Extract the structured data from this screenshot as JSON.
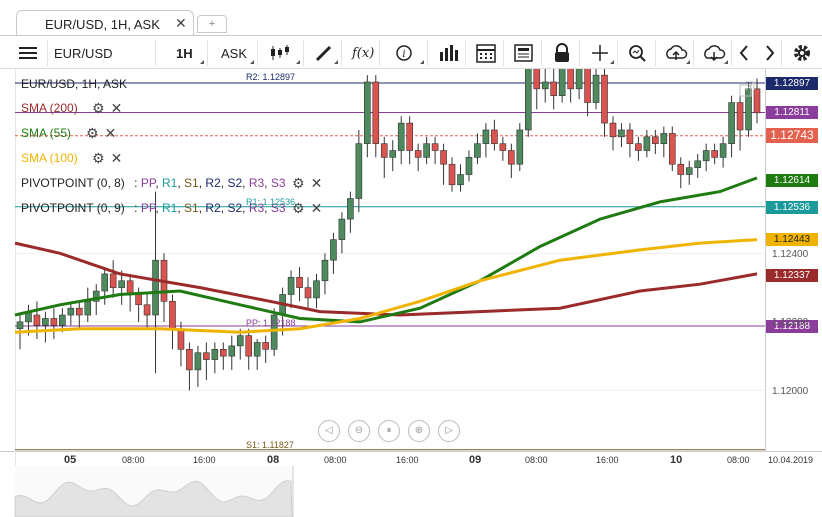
{
  "tab": {
    "title": "EUR/USD, 1H, ASK",
    "close": "✕",
    "add": "+"
  },
  "toolbar": {
    "menu": "menu-icon",
    "symbol": "EUR/USD",
    "timeframe": "1H",
    "side": "ASK",
    "fx": "f(x)",
    "info": "i"
  },
  "legend": {
    "title": "EUR/USD, 1H, ASK",
    "sma200": "SMA (200)",
    "sma55": "SMA (55)",
    "sma100": "SMA (100)",
    "pivot1_name": "PIVOTPOINT (0, 8)",
    "pivot2_name": "PIVOTPOINT (0, 9)",
    "pivot_sep": ":",
    "pivot_keys": [
      "PP",
      "R1",
      "S1",
      "R2",
      "S2",
      "R3",
      "S3"
    ],
    "pivot_commas": [
      ",",
      ",",
      ",",
      ",",
      ",",
      ","
    ]
  },
  "level_labels": {
    "r2": "R2: 1.12897",
    "r1": "R1: 1.12536",
    "pp": "PP: 1.12188",
    "s1": "S1: 1.11827"
  },
  "price_tags": {
    "r2": "1.12897",
    "high": "1.12811",
    "current": "1.12743",
    "sma55": "1.12614",
    "r1": "1.12536",
    "sma100": "1.12443",
    "sma200": "1.12337",
    "pp": "1.12188"
  },
  "price_axis": [
    "1.12400",
    "1.12200",
    "1.12000"
  ],
  "time_axis": {
    "days": [
      "05",
      "08",
      "09",
      "10"
    ],
    "hours": [
      "08:00",
      "16:00",
      "08:00",
      "16:00",
      "08:00",
      "16:00",
      "08:00"
    ],
    "date": "10.04.2019"
  },
  "nav": [
    "◁",
    "⊖",
    "⏸",
    "⊕",
    "▷"
  ],
  "colors": {
    "up": "#4e8a5e",
    "down": "#d9534f",
    "sma200": "#9b2a2a",
    "sma55": "#1f7a12",
    "sma100": "#f0b400",
    "r2": "#1c2a6b",
    "r1": "#1a9a9a",
    "pp": "#8a3d9a",
    "s1": "#7a5a1a",
    "current": "#e4604f"
  },
  "candles": [
    [
      1.1218,
      1.122,
      1.1212,
      1.1222
    ],
    [
      1.122,
      1.1223,
      1.1216,
      1.1225
    ],
    [
      1.1222,
      1.1219,
      1.1215,
      1.1226
    ],
    [
      1.1219,
      1.1221,
      1.1214,
      1.1223
    ],
    [
      1.1221,
      1.1219,
      1.1215,
      1.1224
    ],
    [
      1.1219,
      1.1222,
      1.1217,
      1.1224
    ],
    [
      1.1222,
      1.1224,
      1.1219,
      1.1226
    ],
    [
      1.1224,
      1.1222,
      1.1218,
      1.1226
    ],
    [
      1.1222,
      1.1226,
      1.122,
      1.123
    ],
    [
      1.1226,
      1.1229,
      1.1222,
      1.1231
    ],
    [
      1.1229,
      1.1234,
      1.1225,
      1.1236
    ],
    [
      1.1234,
      1.123,
      1.1227,
      1.1238
    ],
    [
      1.123,
      1.1232,
      1.1225,
      1.1235
    ],
    [
      1.1232,
      1.1228,
      1.1223,
      1.1234
    ],
    [
      1.1228,
      1.1225,
      1.122,
      1.123
    ],
    [
      1.1225,
      1.1222,
      1.1218,
      1.1228
    ],
    [
      1.1222,
      1.1238,
      1.1205,
      1.1258
    ],
    [
      1.1238,
      1.1226,
      1.122,
      1.124
    ],
    [
      1.1226,
      1.1218,
      1.1212,
      1.1228
    ],
    [
      1.1218,
      1.1212,
      1.1207,
      1.122
    ],
    [
      1.1212,
      1.1206,
      1.12,
      1.1214
    ],
    [
      1.1206,
      1.1211,
      1.1201,
      1.1213
    ],
    [
      1.1211,
      1.1209,
      1.1203,
      1.1214
    ],
    [
      1.1209,
      1.1212,
      1.1205,
      1.1214
    ],
    [
      1.1212,
      1.121,
      1.1206,
      1.1214
    ],
    [
      1.121,
      1.1213,
      1.1206,
      1.1216
    ],
    [
      1.1213,
      1.1216,
      1.1209,
      1.1218
    ],
    [
      1.1216,
      1.121,
      1.1206,
      1.1218
    ],
    [
      1.121,
      1.1214,
      1.1206,
      1.1215
    ],
    [
      1.1214,
      1.1212,
      1.1208,
      1.1216
    ],
    [
      1.1212,
      1.1222,
      1.121,
      1.1224
    ],
    [
      1.1222,
      1.1228,
      1.1216,
      1.123
    ],
    [
      1.1228,
      1.1233,
      1.1224,
      1.1235
    ],
    [
      1.1233,
      1.123,
      1.1226,
      1.1236
    ],
    [
      1.123,
      1.1227,
      1.1224,
      1.1233
    ],
    [
      1.1227,
      1.1232,
      1.1224,
      1.1234
    ],
    [
      1.1232,
      1.1238,
      1.1228,
      1.124
    ],
    [
      1.1238,
      1.1244,
      1.1234,
      1.1246
    ],
    [
      1.1244,
      1.125,
      1.124,
      1.1252
    ],
    [
      1.125,
      1.1256,
      1.1246,
      1.1258
    ],
    [
      1.1256,
      1.1272,
      1.1252,
      1.1276
    ],
    [
      1.1272,
      1.129,
      1.1268,
      1.1292
    ],
    [
      1.129,
      1.1272,
      1.1268,
      1.1292
    ],
    [
      1.1272,
      1.1268,
      1.1262,
      1.1274
    ],
    [
      1.1268,
      1.127,
      1.1264,
      1.1273
    ],
    [
      1.127,
      1.1278,
      1.1266,
      1.128
    ],
    [
      1.1278,
      1.127,
      1.1266,
      1.128
    ],
    [
      1.127,
      1.1268,
      1.1264,
      1.1272
    ],
    [
      1.1268,
      1.1272,
      1.1266,
      1.1274
    ],
    [
      1.1272,
      1.127,
      1.1266,
      1.1274
    ],
    [
      1.127,
      1.1266,
      1.126,
      1.1272
    ],
    [
      1.1266,
      1.126,
      1.1258,
      1.1268
    ],
    [
      1.126,
      1.1263,
      1.1258,
      1.1266
    ],
    [
      1.1263,
      1.1268,
      1.1261,
      1.127
    ],
    [
      1.1268,
      1.1272,
      1.1266,
      1.1275
    ],
    [
      1.1272,
      1.1276,
      1.1268,
      1.1278
    ],
    [
      1.1276,
      1.1272,
      1.127,
      1.1279
    ],
    [
      1.1272,
      1.127,
      1.1267,
      1.1274
    ],
    [
      1.127,
      1.1266,
      1.1262,
      1.1272
    ],
    [
      1.1266,
      1.1276,
      1.1264,
      1.1278
    ],
    [
      1.1276,
      1.1296,
      1.1274,
      1.1298
    ],
    [
      1.1296,
      1.1288,
      1.1282,
      1.1298
    ],
    [
      1.1288,
      1.129,
      1.1284,
      1.1294
    ],
    [
      1.129,
      1.1286,
      1.1282,
      1.1294
    ],
    [
      1.1286,
      1.1294,
      1.1284,
      1.1296
    ],
    [
      1.1294,
      1.1288,
      1.1284,
      1.13
    ],
    [
      1.1288,
      1.1296,
      1.1285,
      1.1302
    ],
    [
      1.1296,
      1.1284,
      1.128,
      1.1298
    ],
    [
      1.1284,
      1.1292,
      1.1282,
      1.1294
    ],
    [
      1.1292,
      1.1278,
      1.1274,
      1.1294
    ],
    [
      1.1278,
      1.1274,
      1.127,
      1.128
    ],
    [
      1.1274,
      1.1276,
      1.1271,
      1.1278
    ],
    [
      1.1276,
      1.1272,
      1.1268,
      1.1278
    ],
    [
      1.1272,
      1.127,
      1.1267,
      1.1274
    ],
    [
      1.127,
      1.1274,
      1.1268,
      1.1276
    ],
    [
      1.1274,
      1.1272,
      1.1269,
      1.1276
    ],
    [
      1.1272,
      1.1275,
      1.1268,
      1.1277
    ],
    [
      1.1275,
      1.1266,
      1.1264,
      1.1277
    ],
    [
      1.1266,
      1.1263,
      1.1259,
      1.1268
    ],
    [
      1.1263,
      1.1265,
      1.126,
      1.1267
    ],
    [
      1.1265,
      1.1267,
      1.1262,
      1.1269
    ],
    [
      1.1267,
      1.127,
      1.1264,
      1.1272
    ],
    [
      1.127,
      1.1268,
      1.1266,
      1.1272
    ],
    [
      1.1268,
      1.1272,
      1.1265,
      1.1274
    ],
    [
      1.1272,
      1.1284,
      1.1268,
      1.1286
    ],
    [
      1.1284,
      1.1276,
      1.127,
      1.1286
    ],
    [
      1.1276,
      1.1288,
      1.1274,
      1.129
    ],
    [
      1.1288,
      1.1281,
      1.1278,
      1.1291
    ]
  ]
}
